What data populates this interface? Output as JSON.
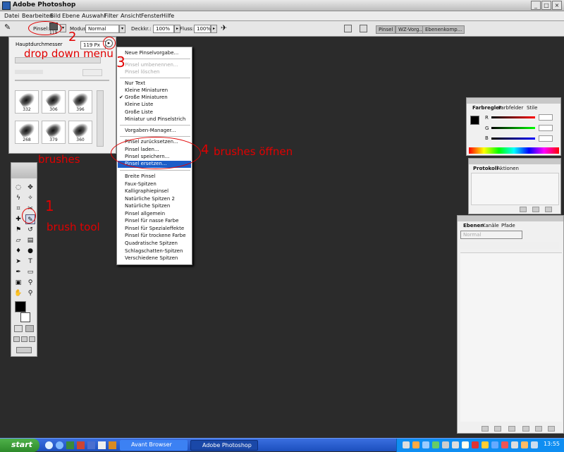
{
  "window": {
    "title": "Adobe Photoshop"
  },
  "menu": [
    "Datei",
    "Bearbeiten",
    "Bild",
    "Ebene",
    "Auswahl",
    "Filter",
    "Ansicht",
    "Fenster",
    "Hilfe"
  ],
  "options_bar": {
    "pinsel_label": "Pinsel:",
    "brush_size": "119",
    "modus_label": "Modus:",
    "modus_value": "Normal",
    "deckkr_label": "Deckkr.:",
    "deckkr_value": "100%",
    "fluss_label": "Fluss:",
    "fluss_value": "100%",
    "palette_tabs": [
      "Pinsel",
      "WZ-Vorg...",
      "Ebenenkomp..."
    ]
  },
  "brush_picker": {
    "diameter_label": "Hauptdurchmesser",
    "diameter_value": "119 Px",
    "brushes": [
      "332",
      "306",
      "396",
      "268",
      "379",
      "360"
    ]
  },
  "dropdown_menu": {
    "items": [
      {
        "label": "Neue Pinselvorgabe...",
        "state": "normal"
      },
      {
        "label": "Pinsel umbenennen...",
        "state": "disabled"
      },
      {
        "label": "Pinsel löschen",
        "state": "disabled"
      },
      {
        "label": "Nur Text",
        "state": "normal"
      },
      {
        "label": "Kleine Miniaturen",
        "state": "normal"
      },
      {
        "label": "Große Miniaturen",
        "state": "checked"
      },
      {
        "label": "Kleine Liste",
        "state": "normal"
      },
      {
        "label": "Große Liste",
        "state": "normal"
      },
      {
        "label": "Miniatur und Pinselstrich",
        "state": "normal"
      },
      {
        "label": "Vorgaben-Manager...",
        "state": "normal"
      },
      {
        "label": "Pinsel zurücksetzen...",
        "state": "normal"
      },
      {
        "label": "Pinsel laden...",
        "state": "normal"
      },
      {
        "label": "Pinsel speichern...",
        "state": "normal"
      },
      {
        "label": "Pinsel ersetzen...",
        "state": "highlight"
      },
      {
        "label": "Breite Pinsel",
        "state": "normal"
      },
      {
        "label": "Faux-Spitzen",
        "state": "normal"
      },
      {
        "label": "Kalligraphiepinsel",
        "state": "normal"
      },
      {
        "label": "Natürliche Spitzen 2",
        "state": "normal"
      },
      {
        "label": "Natürliche Spitzen",
        "state": "normal"
      },
      {
        "label": "Pinsel allgemein",
        "state": "normal"
      },
      {
        "label": "Pinsel für nasse Farbe",
        "state": "normal"
      },
      {
        "label": "Pinsel für Spezialeffekte",
        "state": "normal"
      },
      {
        "label": "Pinsel für trockene Farbe",
        "state": "normal"
      },
      {
        "label": "Quadratische Spitzen",
        "state": "normal"
      },
      {
        "label": "Schlagschatten-Spitzen",
        "state": "normal"
      },
      {
        "label": "Verschiedene Spitzen",
        "state": "normal"
      }
    ]
  },
  "annotations": {
    "n1": "1",
    "t1": "brush tool",
    "n2": "2",
    "t2": "drop down menu",
    "n3": "3",
    "n4": "4",
    "t4": "brushes öffnen",
    "brushes": "brushes"
  },
  "panels": {
    "color_tabs": [
      "Farbregler",
      "Farbfelder",
      "Stile"
    ],
    "color_channels": [
      "R",
      "G",
      "B"
    ],
    "history_tabs": [
      "Protokoll",
      "Aktionen"
    ],
    "layers_tabs": [
      "Ebenen",
      "Kanäle",
      "Pfade"
    ],
    "layers_mode": "Normal"
  },
  "taskbar": {
    "start": "start",
    "tasks": [
      "Avant Browser",
      "Adobe Photoshop"
    ],
    "clock": "13:55"
  },
  "colors": {
    "highlight": "#1c5dc8",
    "annotation": "#e10000",
    "taskbar": "#1c4fbd"
  }
}
